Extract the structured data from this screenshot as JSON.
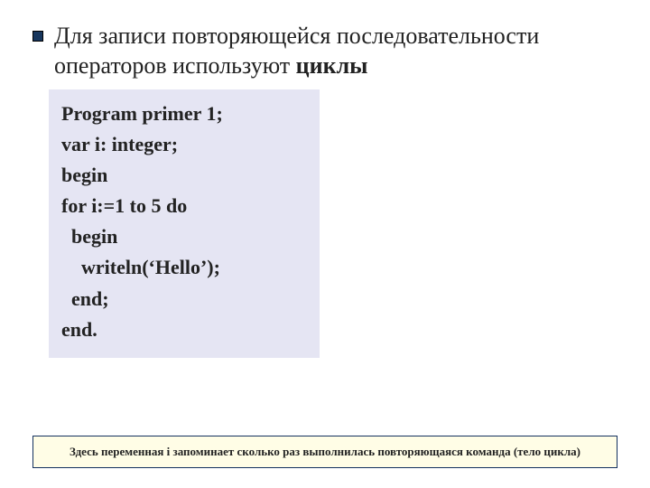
{
  "title": {
    "line1": "Для  записи повторяющейся последовательности операторов используют ",
    "bold": "циклы"
  },
  "code": {
    "lines": [
      "Program primer 1;",
      "var i: integer;",
      "begin",
      "for i:=1 to 5 do",
      "  begin",
      "    writeln(‘Hello’);",
      "  end;",
      "end."
    ]
  },
  "footnote": "Здесь переменная i запоминает сколько раз выполнилась повторяющаяся команда (тело цикла)"
}
